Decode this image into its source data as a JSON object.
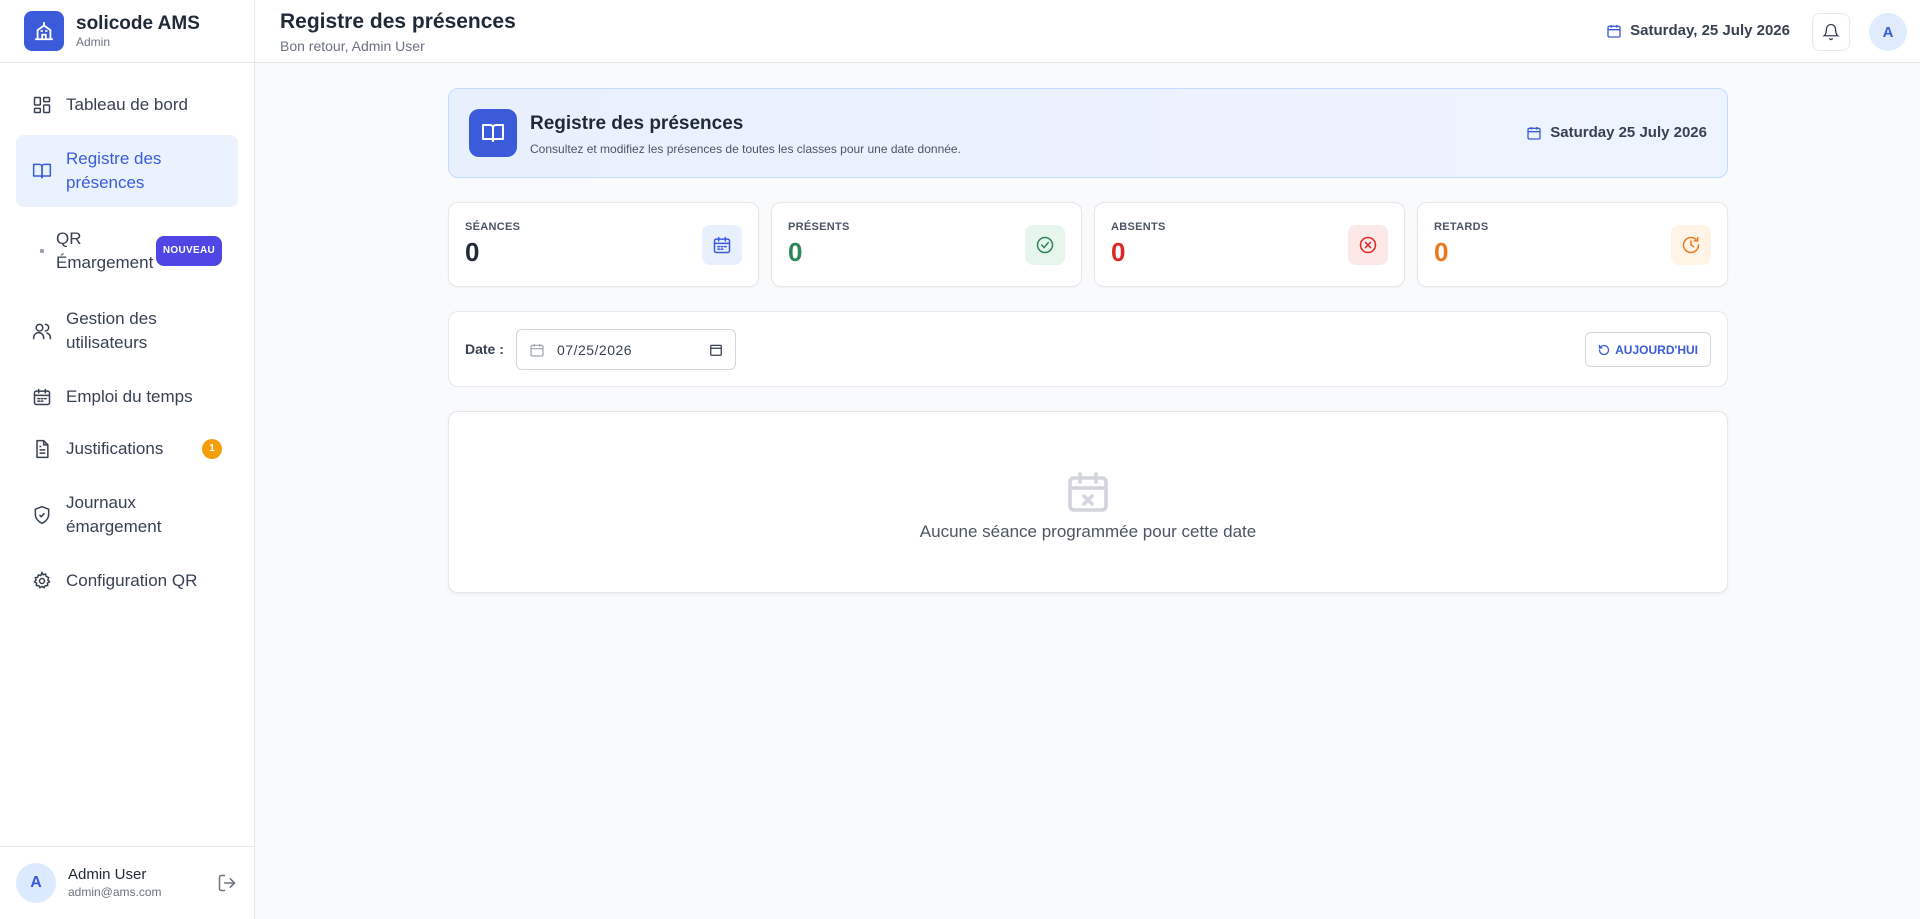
{
  "brand": {
    "name": "solicode AMS",
    "role": "Admin"
  },
  "sidebar": {
    "items": [
      {
        "label": "Tableau de bord",
        "icon": "dashboard-icon"
      },
      {
        "label": "Registre des présences",
        "icon": "book-icon",
        "active": true
      },
      {
        "label": "QR Émargement",
        "icon": "qr-icon",
        "badge": "NOUVEAU"
      },
      {
        "label": "Gestion des utilisateurs",
        "icon": "users-icon"
      },
      {
        "label": "Emploi du temps",
        "icon": "calendar-icon"
      },
      {
        "label": "Justifications",
        "icon": "document-icon",
        "badge": "1"
      },
      {
        "label": "Journaux émargement",
        "icon": "shield-check-icon"
      },
      {
        "label": "Configuration QR",
        "icon": "gear-icon"
      }
    ]
  },
  "user": {
    "avatar": "A",
    "name": "Admin User",
    "email": "admin@ams.com"
  },
  "header": {
    "title": "Registre des présences",
    "subtitle": "Bon retour, Admin User",
    "date": "Saturday, 25 July 2026",
    "avatar": "A"
  },
  "banner": {
    "title": "Registre des présences",
    "subtitle": "Consultez et modifiez les présences de toutes les classes pour une date donnée.",
    "date": "Saturday 25 July 2026"
  },
  "stats": [
    {
      "label": "SÉANCES",
      "value": "0",
      "color": "#1f2937",
      "icon": "calendar-icon",
      "icon_color": "#3b5bdb",
      "icon_bg": "#e8f0fe"
    },
    {
      "label": "PRÉSENTS",
      "value": "0",
      "color": "#2f855a",
      "icon": "check-circle-icon",
      "icon_color": "#2f855a",
      "icon_bg": "#e6f6ec"
    },
    {
      "label": "ABSENTS",
      "value": "0",
      "color": "#dc2626",
      "icon": "x-circle-icon",
      "icon_color": "#dc2626",
      "icon_bg": "#fde8e8"
    },
    {
      "label": "RETARDS",
      "value": "0",
      "color": "#ea7a1c",
      "icon": "clock-icon",
      "icon_color": "#ea7a1c",
      "icon_bg": "#fff4e5"
    }
  ],
  "filter": {
    "label": "Date :",
    "date_value": "07/25/2026",
    "today_button": "AUJOURD'HUI"
  },
  "empty_state": {
    "message": "Aucune séance programmée pour cette date"
  },
  "colors": {
    "accent": "#3b5bdb",
    "active_bg": "#eaf2fd"
  }
}
